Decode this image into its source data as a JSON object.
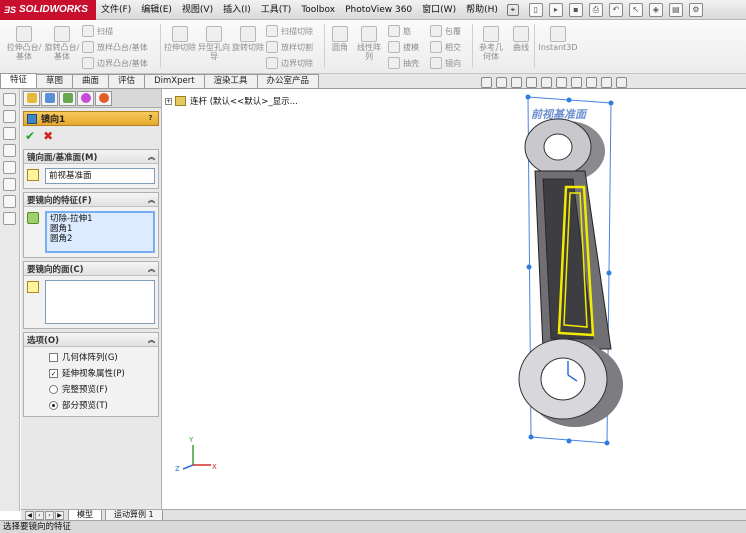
{
  "app": {
    "brand": "SOLIDWORKS",
    "menus": [
      "文件(F)",
      "编辑(E)",
      "视图(V)",
      "插入(I)",
      "工具(T)",
      "Toolbox",
      "PhotoView 360",
      "窗口(W)",
      "帮助(H)"
    ]
  },
  "commands": {
    "extrude_boss": "拉伸凸台/基体",
    "revolve_boss": "旋转凸台/基体",
    "sweep": "扫描",
    "loft_boss": "放样凸台/基体",
    "boundary_boss": "边界凸台/基体",
    "extrude_cut": "拉伸切除",
    "hole_wizard": "异型孔向导",
    "revolve_cut": "旋转切除",
    "swept_cut": "扫描切除",
    "lofted_cut": "放样切割",
    "boundary_cut": "边界切除",
    "fillet": "圆角",
    "linear_pattern": "线性阵列",
    "rib": "筋",
    "draft": "拔模",
    "shell": "抽壳",
    "wrap": "包覆",
    "intersect": "相交",
    "mirror": "镜向",
    "ref_geometry": "参考几何体",
    "curves": "曲线",
    "instant3d": "Instant3D"
  },
  "tabs": [
    "特征",
    "草图",
    "曲面",
    "评估",
    "DimXpert",
    "渲染工具",
    "办公室产品"
  ],
  "property_manager": {
    "title": "镜向1",
    "help": "?",
    "mirror_face_section": "镜向面/基准面(M)",
    "mirror_face_value": "前视基准面",
    "features_section": "要镜向的特征(F)",
    "features": [
      "切除-拉伸1",
      "圆角1",
      "圆角2"
    ],
    "faces_section": "要镜向的面(C)",
    "options_section": "选项(O)",
    "options": {
      "geometry_pattern": "几何体阵列(G)",
      "propagate_visual": "延伸视象属性(P)",
      "full_preview": "完整预览(F)",
      "partial_preview": "部分预览(T)"
    }
  },
  "tree": {
    "part_name": "连杆 (默认<<默认>_显示..."
  },
  "viewport": {
    "plane_label": "前视基准面",
    "axes": {
      "x": "X",
      "y": "Y",
      "z": "Z"
    }
  },
  "bottom_tabs": [
    "模型",
    "运动算例 1"
  ],
  "status": "选择要镜向的特征",
  "colors": {
    "brand_red": "#c8102e",
    "header_orange": "#e6a82c",
    "selection_yellow": "#f2ea00",
    "plane_blue": "#4a84e0"
  }
}
